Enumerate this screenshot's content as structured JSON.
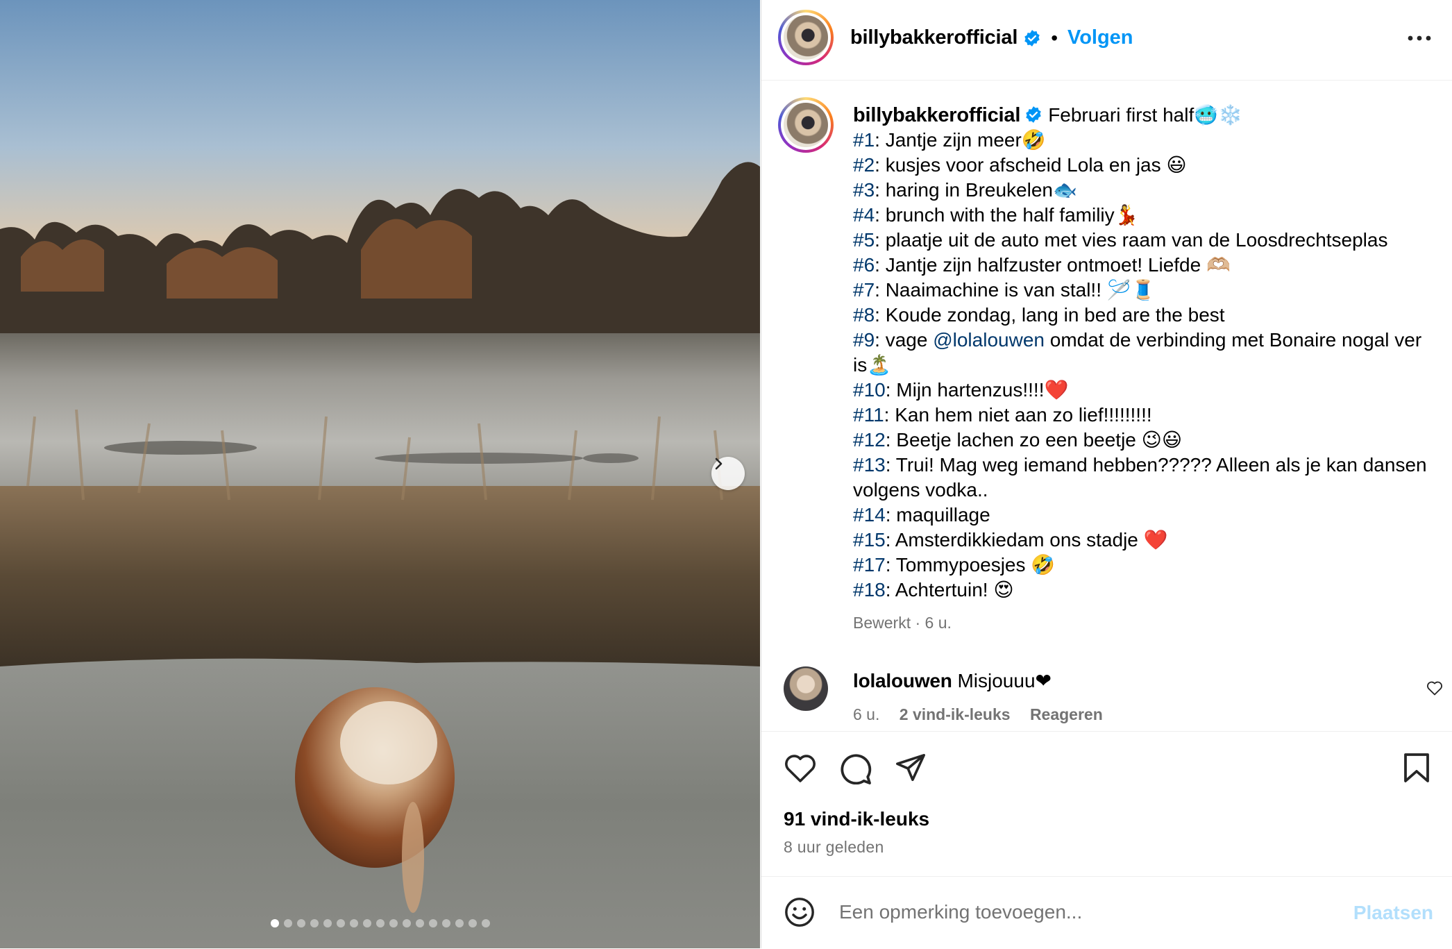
{
  "post": {
    "username": "billybakkerofficial",
    "follow_label": "Volgen",
    "separator": "•",
    "caption_title": "Februari first half🥶❄️",
    "caption_lines": [
      {
        "tag": "#1",
        "text": ": Jantje zijn meer🤣"
      },
      {
        "tag": "#2",
        "text": ": kusjes voor afscheid Lola en jas 😃"
      },
      {
        "tag": "#3",
        "text": ": haring in Breukelen🐟"
      },
      {
        "tag": "#4",
        "text": ": brunch with the half familiy💃"
      },
      {
        "tag": "#5",
        "text": ": plaatje uit de auto met vies raam van de Loosdrechtseplas"
      },
      {
        "tag": "#6",
        "text": ": Jantje zijn halfzuster ontmoet! Liefde 🫶🏼"
      },
      {
        "tag": "#7",
        "text": ": Naaimachine is van stal!! 🪡🧵"
      },
      {
        "tag": "#8",
        "text": ": Koude zondag, lang in bed are the best"
      },
      {
        "tag": "#9",
        "text_before": ": vage ",
        "mention": "@lolalouwen",
        "text": " omdat de verbinding met Bonaire nogal ver is🏝️"
      },
      {
        "tag": "#10",
        "text": ": Mijn hartenzus!!!!❤️"
      },
      {
        "tag": "#11",
        "text": ": Kan hem niet aan zo lief!!!!!!!!!"
      },
      {
        "tag": "#12",
        "text": ": Beetje lachen zo een beetje 😉😃"
      },
      {
        "tag": "#13",
        "text": ": Trui! Mag weg iemand hebben????? Alleen als je kan dansen volgens vodka.."
      },
      {
        "tag": "#14",
        "text": ": maquillage"
      },
      {
        "tag": "#15",
        "text": ": Amsterdikkiedam ons stadje ❤️"
      },
      {
        "tag": "#17",
        "text": ": Tommypoesjes 🤣"
      },
      {
        "tag": "#18",
        "text": ": Achtertuin! 😍"
      }
    ],
    "edited_meta": "Bewerkt · 6 u.",
    "likes": "91 vind-ik-leuks",
    "time_ago": "8 uur geleden",
    "carousel_count": 17,
    "carousel_active_index": 0
  },
  "comment": {
    "username": "lolalouwen",
    "text": "Misjouuu❤",
    "time": "6 u.",
    "likes": "2 vind-ik-leuks",
    "reply_label": "Reageren"
  },
  "composer": {
    "placeholder": "Een opmerking toevoegen...",
    "post_label": "Plaatsen"
  },
  "colors": {
    "link": "#0095f6",
    "hashtag": "#00376b",
    "muted": "#737373",
    "disabled_post": "#b2dffc"
  },
  "icons": [
    "verified-badge-icon",
    "more-options-icon",
    "heart-icon",
    "comment-icon",
    "share-icon",
    "bookmark-icon",
    "emoji-icon",
    "chevron-right-icon"
  ]
}
